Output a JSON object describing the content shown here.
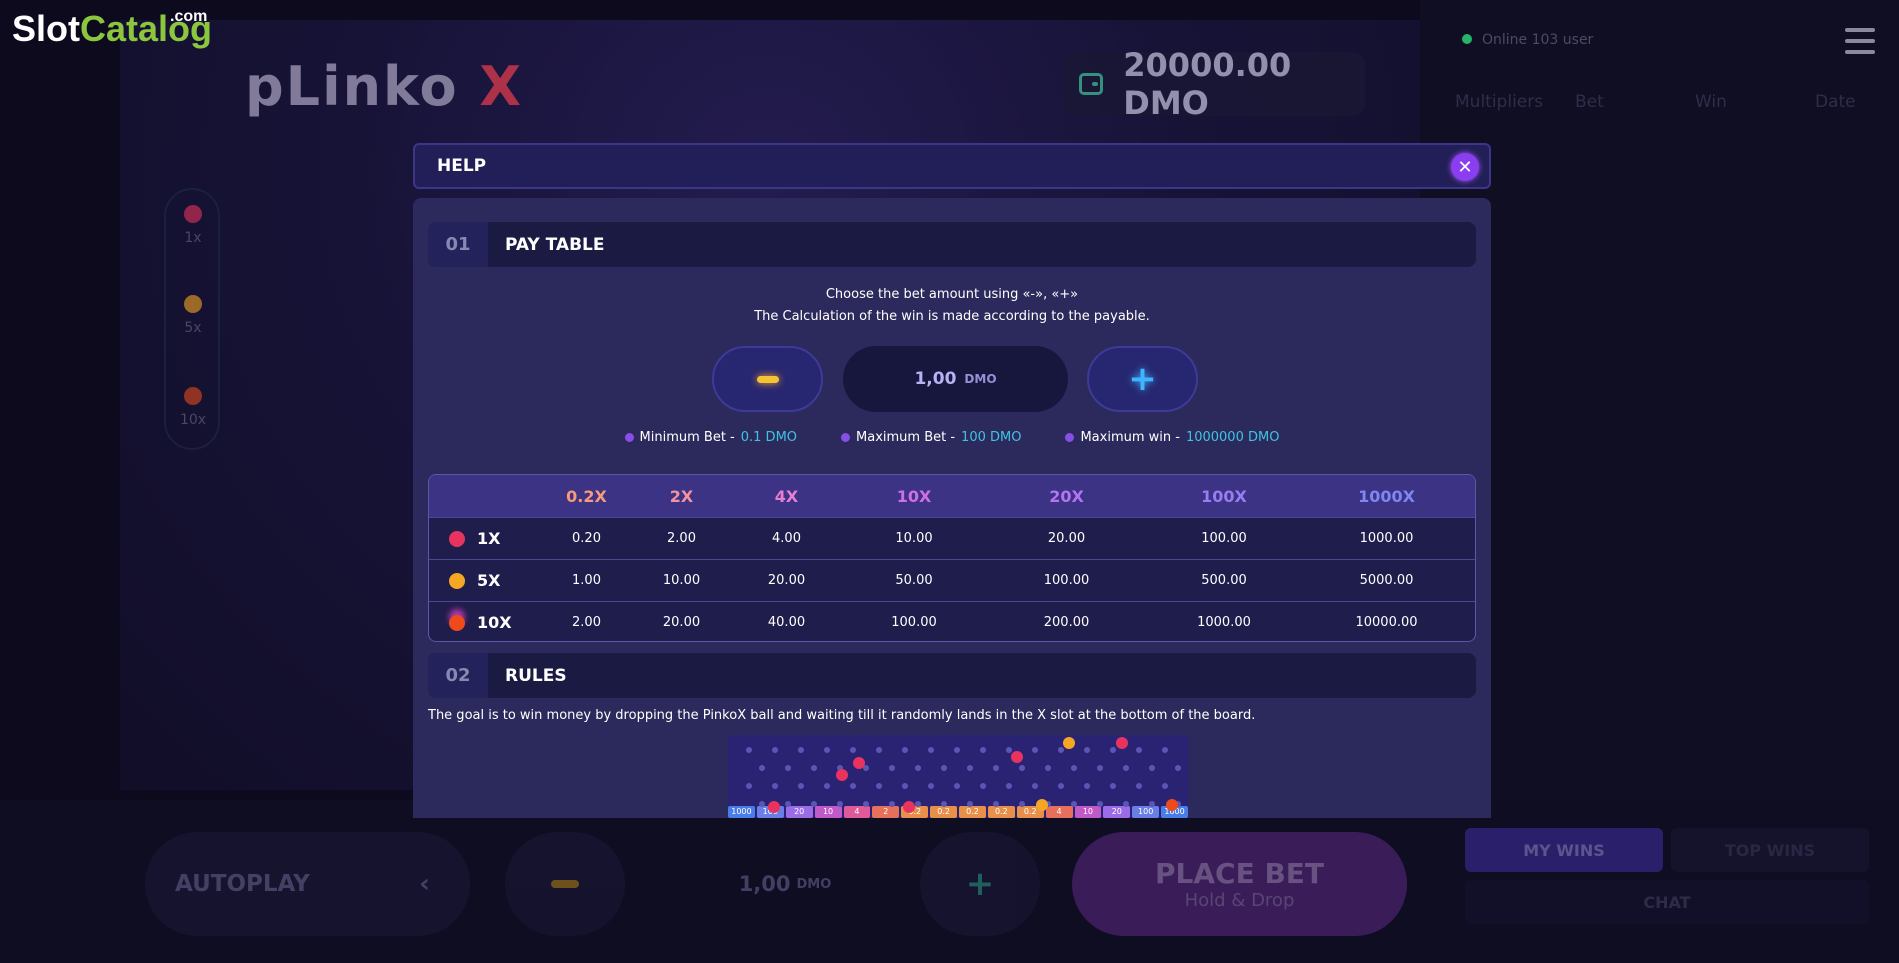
{
  "watermark": {
    "brand_part1": "Slot",
    "brand_part2": "Catalog",
    "suffix": ".com"
  },
  "game": {
    "title_part1": "pLinko",
    "title_part2": "X"
  },
  "balance": {
    "value": "20000.00 DMO",
    "icon": "wallet-icon"
  },
  "side_legend": [
    {
      "label": "1x",
      "color": "#e8335f"
    },
    {
      "label": "5x",
      "color": "#f5a623"
    },
    {
      "label": "10x",
      "color": "#e34a1c"
    }
  ],
  "right_panel": {
    "online_text": "Online  103 user",
    "columns": [
      "Multipliers",
      "Bet",
      "Win",
      "Date"
    ],
    "tabs": [
      "MY WINS",
      "TOP WINS"
    ],
    "chat": "CHAT"
  },
  "bottom_controls": {
    "autoplay": "AUTOPLAY",
    "autoplay_chevron": "‹",
    "amount": "1,00",
    "currency": "DMO",
    "plus": "+",
    "place_bet": "PLACE BET",
    "place_bet_sub": "Hold & Drop"
  },
  "modal": {
    "title": "HELP",
    "close": "✕",
    "section1": {
      "num": "01",
      "title": "PAY TABLE"
    },
    "instructions": [
      "Choose the bet amount using «-», «+»",
      "The Calculation of the win is made according to the payable."
    ],
    "stepper": {
      "amount": "1,00",
      "currency": "DMO",
      "plus": "+"
    },
    "limits": [
      {
        "label": "Minimum Bet -",
        "value": "0.1 DMO"
      },
      {
        "label": "Maximum Bet -",
        "value": "100 DMO"
      },
      {
        "label": "Maximum win -",
        "value": "1000000 DMO"
      }
    ],
    "paytable": {
      "headers": [
        "0.2X",
        "2X",
        "4X",
        "10X",
        "20X",
        "100X",
        "1000X"
      ],
      "header_colors": [
        "#f59a7a",
        "#f592a0",
        "#e57fd2",
        "#d06ee8",
        "#b574f0",
        "#9a7cf2",
        "#7e86f4"
      ],
      "rows": [
        {
          "label": "1X",
          "ball": "#e8335f",
          "values": [
            "0.20",
            "2.00",
            "4.00",
            "10.00",
            "20.00",
            "100.00",
            "1000.00"
          ]
        },
        {
          "label": "5X",
          "ball": "#f5a623",
          "values": [
            "1.00",
            "10.00",
            "20.00",
            "50.00",
            "100.00",
            "500.00",
            "5000.00"
          ]
        },
        {
          "label": "10X",
          "ball": "#ef4a1a",
          "values": [
            "2.00",
            "20.00",
            "40.00",
            "100.00",
            "200.00",
            "1000.00",
            "10000.00"
          ]
        }
      ]
    },
    "section2": {
      "num": "02",
      "title": "RULES"
    },
    "rules_text": "The goal is to win money by dropping the PinkoX ball and waiting till it randomly lands in the X slot at the bottom of the board.",
    "board_slots": [
      "1000",
      "100",
      "20",
      "10",
      "4",
      "2",
      "0.2",
      "0.2",
      "0.2",
      "0.2",
      "0.2",
      "4",
      "10",
      "20",
      "100",
      "1000"
    ]
  }
}
